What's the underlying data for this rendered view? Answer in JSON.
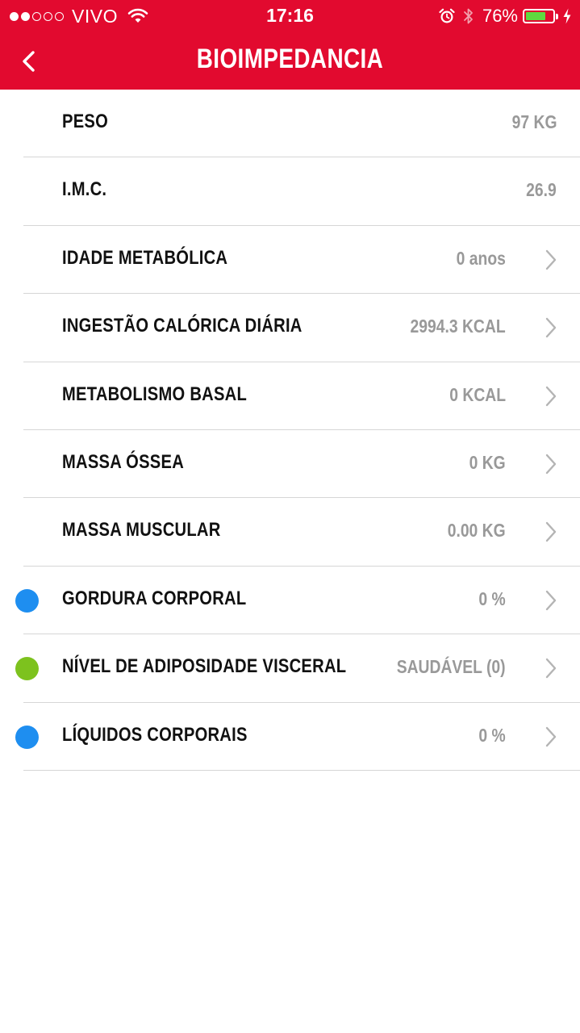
{
  "status_bar": {
    "signal_dots_filled": 2,
    "signal_dots_total": 5,
    "carrier": "VIVO",
    "time": "17:16",
    "battery_percent": "76%",
    "battery_level": 0.76
  },
  "nav": {
    "title": "BIOIMPEDANCIA",
    "back_icon": "chevron-left-icon"
  },
  "colors": {
    "header_bg": "#e20a2f",
    "indicator_blue": "#1e8ef0",
    "indicator_green": "#7dc21e",
    "value_gray": "#999999",
    "battery_green": "#5fd93f"
  },
  "rows": [
    {
      "label": "PESO",
      "value": "97 KG",
      "chevron": false,
      "indicator": null
    },
    {
      "label": "I.M.C.",
      "value": "26.9",
      "chevron": false,
      "indicator": null
    },
    {
      "label": "IDADE METABÓLICA",
      "value": "0 anos",
      "chevron": true,
      "indicator": null
    },
    {
      "label": "INGESTÃO CALÓRICA DIÁRIA",
      "value": "2994.3 KCAL",
      "chevron": true,
      "indicator": null
    },
    {
      "label": "METABOLISMO BASAL",
      "value": "0 KCAL",
      "chevron": true,
      "indicator": null
    },
    {
      "label": "MASSA ÓSSEA",
      "value": "0 KG",
      "chevron": true,
      "indicator": null
    },
    {
      "label": "MASSA MUSCULAR",
      "value": "0.00 KG",
      "chevron": true,
      "indicator": null
    },
    {
      "label": "GORDURA CORPORAL",
      "value": "0 %",
      "chevron": true,
      "indicator": "#1e8ef0"
    },
    {
      "label": "NÍVEL DE ADIPOSIDADE VISCERAL",
      "value": "SAUDÁVEL (0)",
      "chevron": true,
      "indicator": "#7dc21e"
    },
    {
      "label": "LÍQUIDOS CORPORAIS",
      "value": "0 %",
      "chevron": true,
      "indicator": "#1e8ef0"
    }
  ]
}
